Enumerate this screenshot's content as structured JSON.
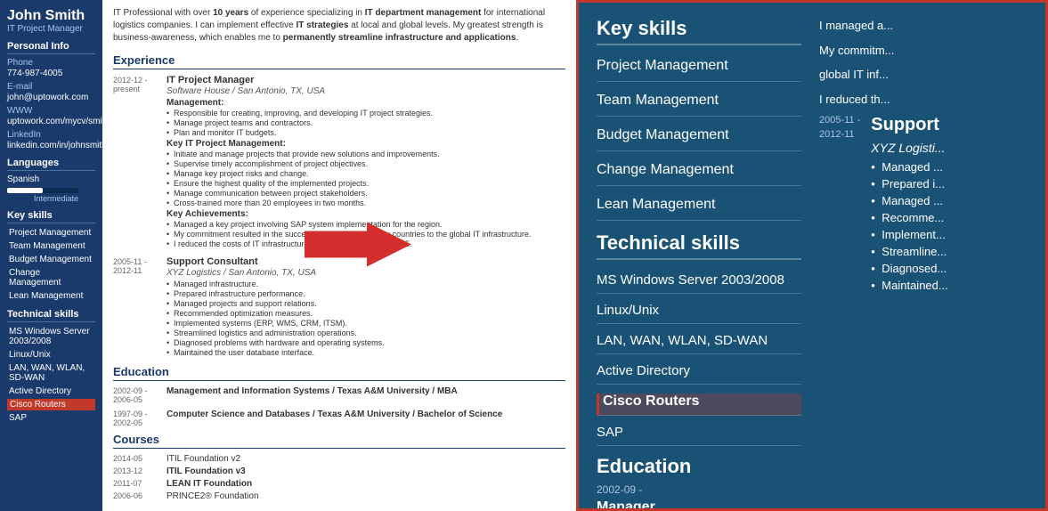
{
  "sidebar": {
    "name": "John Smith",
    "title": "IT Project Manager",
    "personal_info_label": "Personal Info",
    "phone_label": "Phone",
    "phone_value": "774-987-4005",
    "email_label": "E-mail",
    "email_value": "john@uptowork.com",
    "www_label": "WWW",
    "www_value": "uptowork.com/mycv/smith",
    "linkedin_label": "LinkedIn",
    "linkedin_value": "linkedin.com/in/johnsmith",
    "languages_label": "Languages",
    "language_name": "Spanish",
    "language_level": "Intermediate",
    "key_skills_label": "Key skills",
    "skills": [
      "Project Management",
      "Team Management",
      "Budget Management",
      "Change Management",
      "Lean Management"
    ],
    "technical_skills_label": "Technical skills",
    "tech_skills": [
      "MS Windows Server 2003/2008",
      "Linux/Unix",
      "LAN, WAN, WLAN, SD-WAN",
      "Active Directory",
      "Cisco Routers",
      "SAP"
    ]
  },
  "bio": "IT Professional with over 10 years of experience specializing in IT department management for international logistics companies. I can implement effective IT strategies at local and global levels. My greatest strength is business-awareness, which enables me to permanently streamline infrastructure and applications.",
  "experience_label": "Experience",
  "jobs": [
    {
      "date": "2012-12 - present",
      "title": "IT Project Manager",
      "company": "Software House / San Antonio, TX, USA",
      "section1": "Management:",
      "bullets1": [
        "Responsible for creating, improving, and developing IT project strategies.",
        "Manage project teams and contractors.",
        "Plan and monitor IT budgets."
      ],
      "section2": "Key IT Project Management:",
      "bullets2": [
        "Initiate and manage projects that provide new solutions and improvements.",
        "Supervise timely accomplishment of project objectives.",
        "Manage key project risks and change.",
        "Ensure the highest quality of the implemented projects.",
        "Manage communication between project stakeholders.",
        "Cross-trained more than 20 employees in two months."
      ],
      "section3": "Key Achievements:",
      "achievements": [
        "Managed a key project involving SAP system implementation for the region.",
        "My commitment resulted in the successful migration of 5 new countries to the global IT infrastructure.",
        "I reduced the costs of IT infrastructure maintenance by 5% in 2015."
      ]
    },
    {
      "date_start": "2005-11 -",
      "date_end": "2012-11",
      "title": "Support Consultant",
      "company": "XYZ Logistics / San Antonio, TX, USA",
      "bullets": [
        "Managed infrastructure.",
        "Prepared infrastructure performance.",
        "Managed projects and support relations.",
        "Recommended optimization measures.",
        "Implemented systems (ERP, WMS, CRM, ITSM).",
        "Streamlined logistics and administration operations.",
        "Diagnosed problems with hardware and operating systems.",
        "Maintained the user database interface."
      ]
    }
  ],
  "education_label": "Education",
  "education": [
    {
      "date": "2002-09 - 2006-05",
      "title": "Management and Information Systems / Texas A&M University / MBA"
    },
    {
      "date": "1997-09 - 2002-05",
      "title": "Computer Science and Databases / Texas A&M University / Bachelor of Science"
    }
  ],
  "courses_label": "Courses",
  "courses": [
    {
      "date": "2014-05",
      "title": "ITIL Foundation v2"
    },
    {
      "date": "2013-12",
      "title": "ITIL Foundation v3",
      "bold": true
    },
    {
      "date": "2011-07",
      "title": "LEAN IT Foundation",
      "bold": true
    },
    {
      "date": "2006-06",
      "title": "PRINCE2® Foundation"
    }
  ],
  "right_panel": {
    "key_skills_title": "Key skills",
    "key_skills": [
      "Project Management",
      "Team Management",
      "Budget Management",
      "Change Management",
      "Lean Management"
    ],
    "technical_skills_title": "Technical skills",
    "tech_skills": [
      "MS Windows Server 2003/2008",
      "Linux/Unix",
      "LAN, WAN, WLAN, SD-WAN",
      "Active Directory",
      "Cisco Routers",
      "SAP"
    ],
    "education_title": "Education",
    "edu_date": "2002-09 -",
    "edu_title": "Manager",
    "support_title": "Support",
    "support_date_start": "2005-11 -",
    "support_date_end": "2012-11",
    "support_company": "XYZ Logisti...",
    "support_bullets": [
      "• Managed ...",
      "• Prepared i...",
      "• Managed ...",
      "• Recomme...",
      "• Implement...",
      "• Streamline...",
      "• Diagnosed...",
      "• Maintained..."
    ],
    "intro_lines": [
      "I managed a...",
      "My commitm...",
      "global IT inf...",
      "I reduced th..."
    ]
  }
}
